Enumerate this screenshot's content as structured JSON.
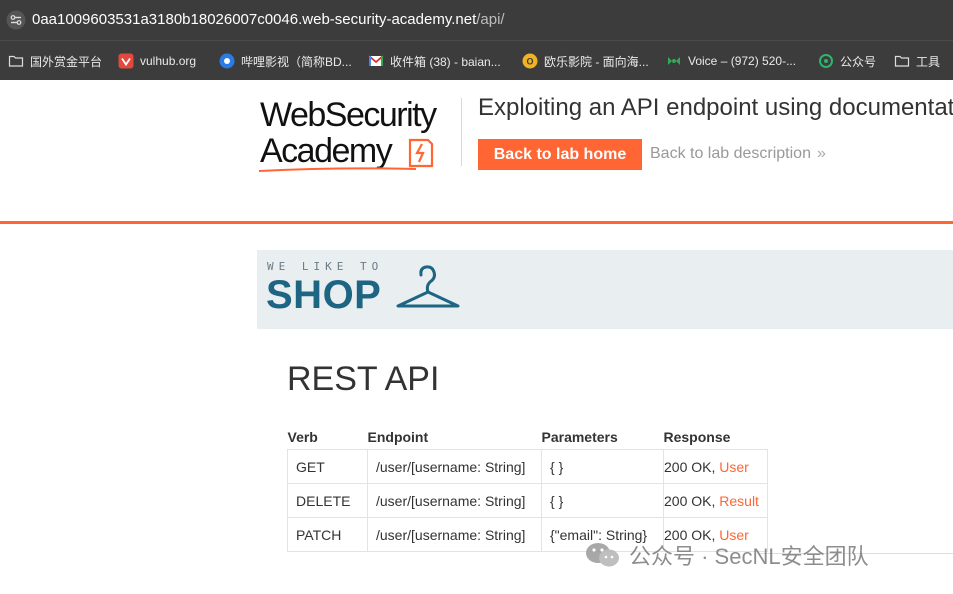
{
  "browser": {
    "url_domain": "0aa1009603531a3180b18026007c0046.web-security-academy.net",
    "url_path": "/api/",
    "bookmarks": [
      {
        "label": "国外赏金平台",
        "icon": "folder-icon"
      },
      {
        "label": "vulhub.org",
        "icon": "vulhub-icon"
      },
      {
        "label": "哔哩影视（简称BD...",
        "icon": "bd-icon"
      },
      {
        "label": "收件箱 (38) - baian...",
        "icon": "gmail-icon"
      },
      {
        "label": "欧乐影院 - 面向海...",
        "icon": "olevod-icon"
      },
      {
        "label": "Voice – (972) 520-...",
        "icon": "voice-icon"
      },
      {
        "label": "公众号",
        "icon": "wechat-icon"
      },
      {
        "label": "工具",
        "icon": "folder-icon"
      }
    ]
  },
  "lab": {
    "logo_line1": "WebSecurity",
    "logo_line2": "Academy",
    "title": "Exploiting an API endpoint using documentation",
    "back_home": "Back to lab home",
    "back_description": "Back to lab description",
    "accent": "#ff6633"
  },
  "shop": {
    "tagline": "WE LIKE TO",
    "name": "SHOP"
  },
  "api": {
    "title": "REST API",
    "headers": [
      "Verb",
      "Endpoint",
      "Parameters",
      "Response"
    ],
    "rows": [
      {
        "verb": "GET",
        "endpoint": "/user/[username: String]",
        "params": "{ }",
        "status": "200 OK,",
        "type": "User"
      },
      {
        "verb": "DELETE",
        "endpoint": "/user/[username: String]",
        "params": "{ }",
        "status": "200 OK,",
        "type": "Result"
      },
      {
        "verb": "PATCH",
        "endpoint": "/user/[username: String]",
        "params": "{\"email\": String}",
        "status": "200 OK,",
        "type": "User"
      }
    ]
  },
  "watermark": {
    "text": "公众号 · SecNL安全团队"
  }
}
